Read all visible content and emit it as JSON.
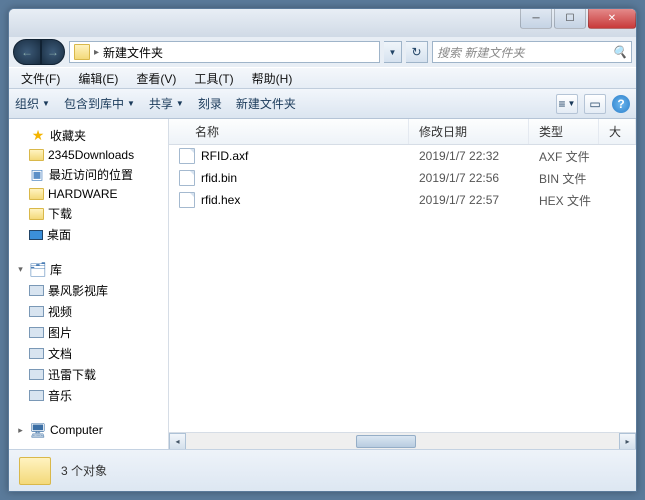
{
  "titlebar": {
    "min": "─",
    "max": "☐",
    "close": "✕"
  },
  "nav": {
    "back": "←",
    "forward": "→",
    "refresh": "↻",
    "drop": "▼"
  },
  "address": {
    "sep": "▸",
    "folder": "新建文件夹"
  },
  "search": {
    "placeholder": "搜索 新建文件夹",
    "icon": "🔍"
  },
  "menubar": [
    {
      "label": "文件(F)"
    },
    {
      "label": "编辑(E)"
    },
    {
      "label": "查看(V)"
    },
    {
      "label": "工具(T)"
    },
    {
      "label": "帮助(H)"
    }
  ],
  "toolbar": {
    "organize": "组织",
    "include": "包含到库中",
    "share": "共享",
    "burn": "刻录",
    "newfolder": "新建文件夹",
    "view_icon": "≡",
    "preview_icon": "▭",
    "help_icon": "?"
  },
  "columns": {
    "name": "名称",
    "date": "修改日期",
    "type": "类型",
    "size": "大"
  },
  "sidebar": {
    "favorites": "收藏夹",
    "fav_items": [
      {
        "label": "2345Downloads"
      },
      {
        "label": "最近访问的位置"
      },
      {
        "label": "HARDWARE"
      },
      {
        "label": "下载"
      },
      {
        "label": "桌面"
      }
    ],
    "libraries": "库",
    "lib_items": [
      {
        "label": "暴风影视库"
      },
      {
        "label": "视频"
      },
      {
        "label": "图片"
      },
      {
        "label": "文档"
      },
      {
        "label": "迅雷下载"
      },
      {
        "label": "音乐"
      }
    ],
    "computer": "Computer"
  },
  "files": [
    {
      "name": "RFID.axf",
      "date": "2019/1/7 22:32",
      "type": "AXF 文件"
    },
    {
      "name": "rfid.bin",
      "date": "2019/1/7 22:56",
      "type": "BIN 文件"
    },
    {
      "name": "rfid.hex",
      "date": "2019/1/7 22:57",
      "type": "HEX 文件"
    }
  ],
  "status": {
    "text": "3 个对象"
  }
}
